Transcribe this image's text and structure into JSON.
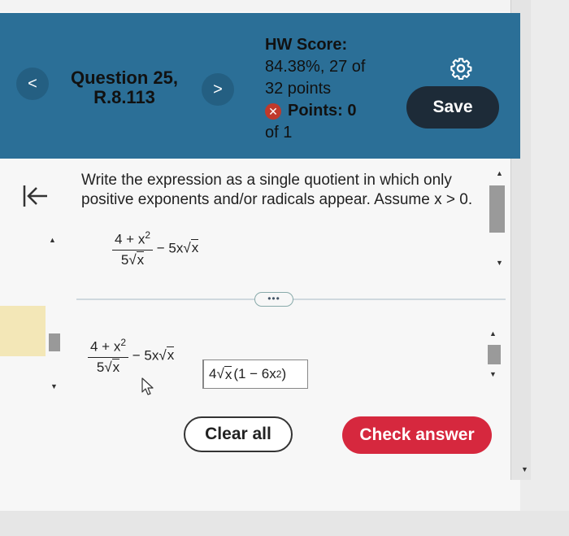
{
  "header": {
    "prev_label": "<",
    "next_label": ">",
    "question_title_line1": "Question 25,",
    "question_title_line2": "R.8.113",
    "hw_score_label": "HW Score:",
    "hw_score_line2": "84.38%, 27 of",
    "hw_score_line3": "32 points",
    "points_label": "Points: 0",
    "points_line2": "of 1",
    "save_label": "Save",
    "settings_icon": "gear-icon"
  },
  "sidebar": {
    "back_icon": "collapse-left-icon"
  },
  "question": {
    "prompt": "Write the expression as a single quotient in which only positive exponents and/or radicals appear. Assume x > 0.",
    "expr": {
      "num": "4 + x",
      "num_exp": "2",
      "den_coef": "5",
      "den_rad": "x",
      "minus": "− 5x",
      "rad2": "x"
    },
    "more_label": "•••"
  },
  "work": {
    "expr": {
      "num": "4 + x",
      "num_exp": "2",
      "den_coef": "5",
      "den_rad": "x",
      "minus": "− 5x",
      "rad2": "x"
    },
    "answer": {
      "coef": "4",
      "rad": "x",
      "paren_open": "(1 − 6x",
      "exp": "2",
      "paren_close": ")"
    }
  },
  "actions": {
    "clear_all": "Clear all",
    "check_answer": "Check answer"
  },
  "colors": {
    "header_bg": "#2b6f97",
    "save_bg": "#1d2b38",
    "check_bg": "#d6283e",
    "error_red": "#c0392b"
  }
}
